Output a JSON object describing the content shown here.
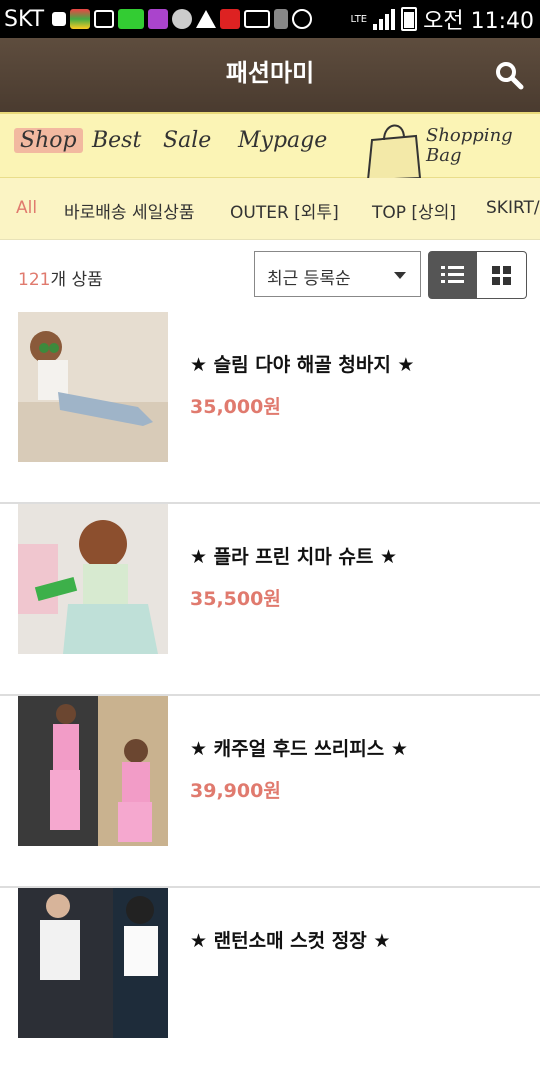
{
  "status_bar": {
    "carrier": "SKT",
    "time": "오전 11:40",
    "network": "LTE"
  },
  "header": {
    "title": "패션마미"
  },
  "nav": {
    "items": [
      "Shop",
      "Best",
      "Sale",
      "Mypage"
    ],
    "bag_label_line1": "Shopping",
    "bag_label_line2": "Bag"
  },
  "categories": [
    "All",
    "바로배송 세일상품",
    "OUTER [외투]",
    "TOP [상의]",
    "SKIRT/"
  ],
  "toolbar": {
    "count_number": "121",
    "count_suffix": "개 상품",
    "sort_selected": "최근 등록순"
  },
  "products": [
    {
      "name": "★ 슬림 다야 해골 청바지 ★",
      "price": "35,000원"
    },
    {
      "name": "★ 플라 프린 치마 슈트 ★",
      "price": "35,500원"
    },
    {
      "name": "★ 캐주얼 후드 쓰리피스 ★",
      "price": "39,900원"
    },
    {
      "name": "★ 랜턴소매 스컷 정장 ★",
      "price": ""
    }
  ],
  "colors": {
    "header_bg": "#4f3f32",
    "nav_bg": "#fbf4b5",
    "accent": "#e07a6e"
  }
}
